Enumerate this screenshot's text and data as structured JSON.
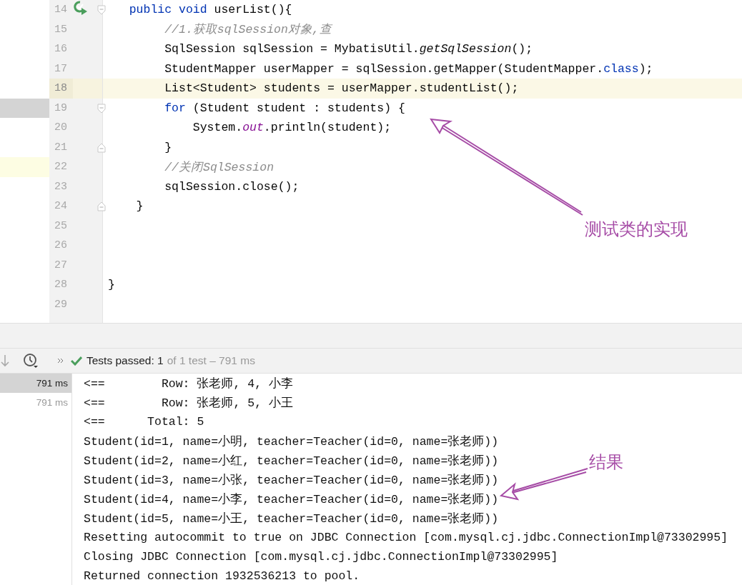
{
  "editor": {
    "lines": [
      {
        "number": "14",
        "current": false,
        "kind": "method-header",
        "tokens": [
          {
            "text": "   public void",
            "kind": "keyword"
          },
          {
            "text": " userList(){",
            "kind": "plain"
          }
        ]
      },
      {
        "number": "15",
        "current": false,
        "kind": "statement",
        "tokens": [
          {
            "text": "        //1.获取sqlSession对象,查",
            "kind": "comment"
          }
        ]
      },
      {
        "number": "16",
        "current": false,
        "kind": "statement",
        "tokens": [
          {
            "text": "        SqlSession sqlSession = MybatisUtil.",
            "kind": "plain"
          },
          {
            "text": "getSqlSession",
            "kind": "static-method"
          },
          {
            "text": "();",
            "kind": "plain"
          }
        ]
      },
      {
        "number": "17",
        "current": false,
        "kind": "statement",
        "tokens": [
          {
            "text": "        StudentMapper userMapper = sqlSession.getMapper(StudentMapper.",
            "kind": "plain"
          },
          {
            "text": "class",
            "kind": "keyword"
          },
          {
            "text": ");",
            "kind": "plain"
          }
        ]
      },
      {
        "number": "18",
        "current": true,
        "kind": "statement",
        "tokens": [
          {
            "text": "        List<Student> students = userMapper.studentList();",
            "kind": "plain"
          }
        ]
      },
      {
        "number": "19",
        "current": false,
        "kind": "block-start",
        "tokens": [
          {
            "text": "        for",
            "kind": "keyword"
          },
          {
            "text": " (Student student : students) {",
            "kind": "plain"
          }
        ]
      },
      {
        "number": "20",
        "current": false,
        "kind": "statement",
        "tokens": [
          {
            "text": "            System.",
            "kind": "plain"
          },
          {
            "text": "out",
            "kind": "static-field"
          },
          {
            "text": ".println(student);",
            "kind": "plain"
          }
        ]
      },
      {
        "number": "21",
        "current": false,
        "kind": "block-end",
        "tokens": [
          {
            "text": "        }",
            "kind": "plain"
          }
        ]
      },
      {
        "number": "22",
        "current": false,
        "kind": "statement",
        "tokens": [
          {
            "text": "        //关闭SqlSession",
            "kind": "comment"
          }
        ]
      },
      {
        "number": "23",
        "current": false,
        "kind": "statement",
        "tokens": [
          {
            "text": "        sqlSession.close();",
            "kind": "plain"
          }
        ]
      },
      {
        "number": "24",
        "current": false,
        "kind": "block-end",
        "tokens": [
          {
            "text": "    }",
            "kind": "plain"
          }
        ]
      },
      {
        "number": "25",
        "current": false,
        "kind": "blank"
      },
      {
        "number": "26",
        "current": false,
        "kind": "blank"
      },
      {
        "number": "27",
        "current": false,
        "kind": "blank"
      },
      {
        "number": "28",
        "current": false,
        "kind": "statement",
        "tokens": [
          {
            "text": "}",
            "kind": "plain"
          }
        ]
      },
      {
        "number": "29",
        "current": false,
        "kind": "blank"
      }
    ]
  },
  "test_bar": {
    "status": "Tests passed: 1",
    "detail": "of 1 test – 791 ms"
  },
  "test_tree": [
    {
      "time": "791 ms",
      "selected": true
    },
    {
      "time": "791 ms",
      "selected": false
    }
  ],
  "console": [
    "<==        Row: 张老师, 4, 小李",
    "<==        Row: 张老师, 5, 小王",
    "<==      Total: 5",
    "Student(id=1, name=小明, teacher=Teacher(id=0, name=张老师))",
    "Student(id=2, name=小红, teacher=Teacher(id=0, name=张老师))",
    "Student(id=3, name=小张, teacher=Teacher(id=0, name=张老师))",
    "Student(id=4, name=小李, teacher=Teacher(id=0, name=张老师))",
    "Student(id=5, name=小王, teacher=Teacher(id=0, name=张老师))",
    "Resetting autocommit to true on JDBC Connection [com.mysql.cj.jdbc.ConnectionImpl@73302995]",
    "Closing JDBC Connection [com.mysql.cj.jdbc.ConnectionImpl@73302995]",
    "Returned connection 1932536213 to pool."
  ],
  "annotations": [
    {
      "label": "测试类的实现"
    },
    {
      "label": "结果"
    }
  ]
}
